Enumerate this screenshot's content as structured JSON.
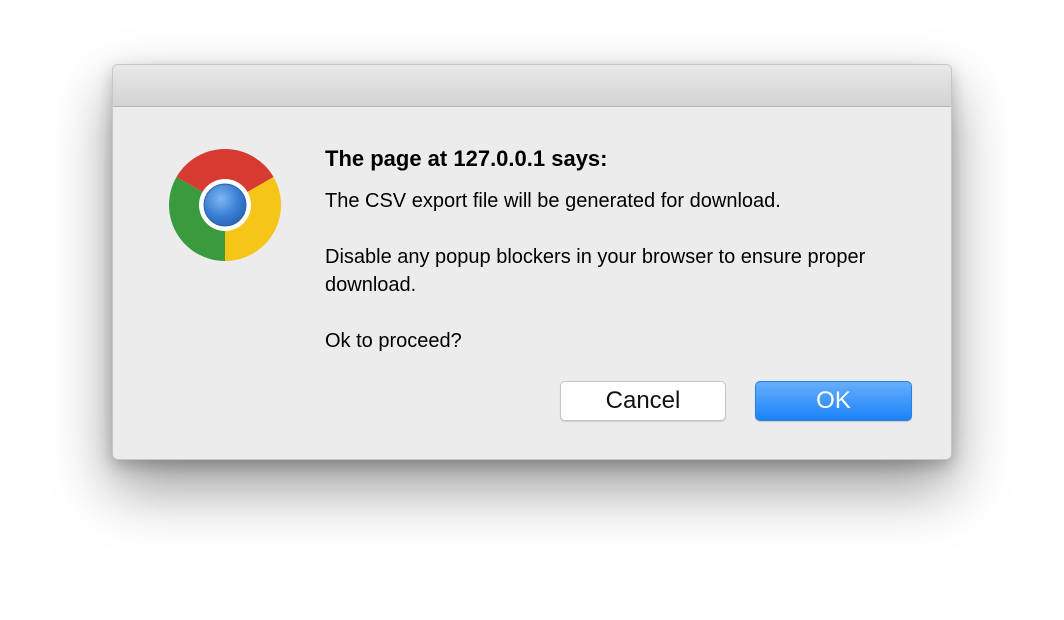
{
  "dialog": {
    "icon": "chrome-logo-icon",
    "heading": "The page at 127.0.0.1 says:",
    "messages": [
      "The CSV export file will be generated for download.",
      "Disable any popup blockers in your browser to ensure proper download.",
      "Ok to proceed?"
    ],
    "buttons": {
      "cancel_label": "Cancel",
      "ok_label": "OK"
    }
  },
  "colors": {
    "ok_button": "#1b83f8",
    "dialog_background": "#ececec"
  }
}
